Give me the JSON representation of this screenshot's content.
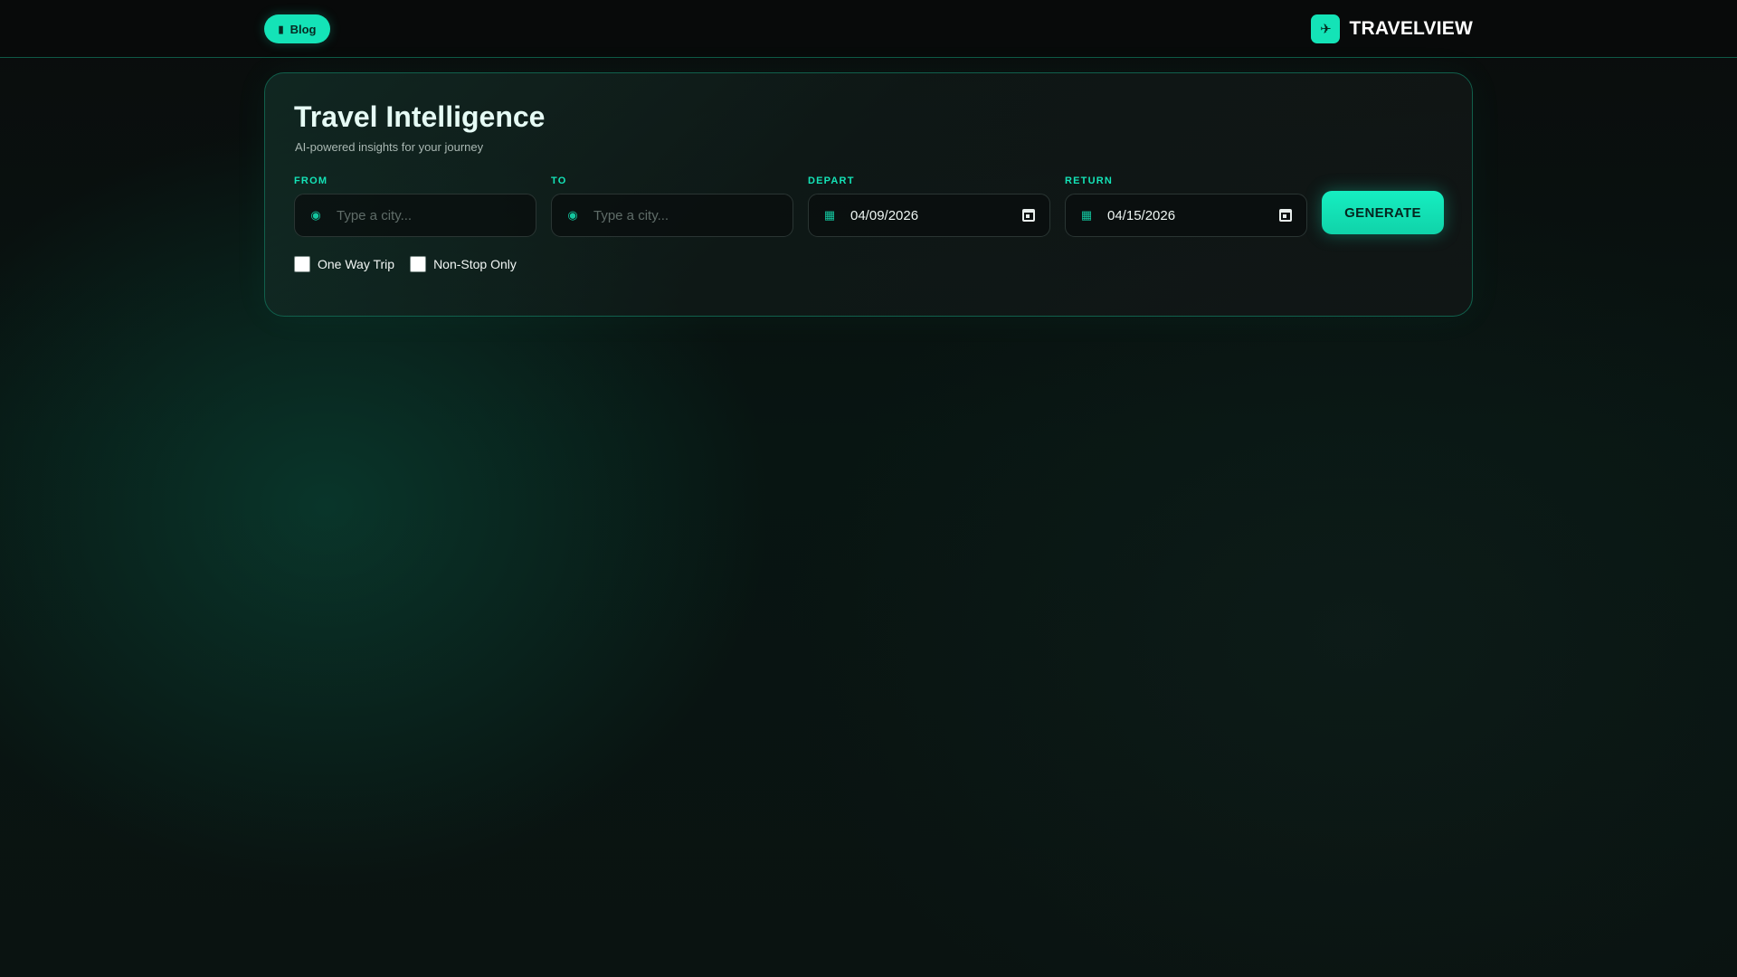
{
  "header": {
    "blog_label": "Blog",
    "blog_icon": "book-icon",
    "brand_icon": "plane-icon",
    "brand_name": "TRAVELVIEW"
  },
  "card": {
    "title": "Travel Intelligence",
    "subtitle": "AI-powered insights for your journey",
    "fields": [
      {
        "label": "FROM",
        "placeholder": "Type a city...",
        "value": "",
        "icon": "location-pin-icon"
      },
      {
        "label": "TO",
        "placeholder": "Type a city...",
        "value": "",
        "icon": "location-pin-icon"
      },
      {
        "label": "DEPART",
        "placeholder": "",
        "value": "04/09/2026",
        "icon": "calendar-icon"
      },
      {
        "label": "RETURN",
        "placeholder": "",
        "value": "04/15/2026",
        "icon": "calendar-icon"
      }
    ],
    "generate_label": "GENERATE",
    "options": [
      {
        "label": "One Way Trip",
        "checked": false
      },
      {
        "label": "Non-Stop Only",
        "checked": false
      }
    ]
  },
  "colors": {
    "accent": "#14e3b7",
    "background": "#0a0c0c",
    "border": "#11604c"
  }
}
